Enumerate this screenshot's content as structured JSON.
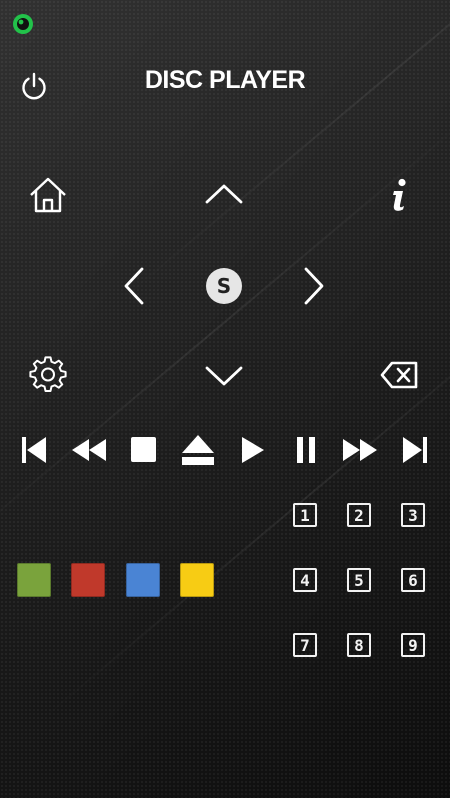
{
  "header": {
    "title": "DISC PLAYER",
    "status_icon": "eye-status-icon",
    "status_color": "#22c24a",
    "power_icon": "power-icon"
  },
  "navigation": {
    "home_icon": "home-icon",
    "info_icon": "info-icon",
    "up_icon": "chevron-up-icon",
    "down_icon": "chevron-down-icon",
    "left_icon": "chevron-left-icon",
    "right_icon": "chevron-right-icon",
    "ok_label": "S",
    "settings_icon": "gear-icon",
    "back_icon": "backspace-icon"
  },
  "transport": [
    "skip-previous-icon",
    "rewind-icon",
    "stop-icon",
    "eject-icon",
    "play-icon",
    "pause-icon",
    "fast-forward-icon",
    "skip-next-icon"
  ],
  "color_keys": [
    {
      "name": "green",
      "color": "#7aa33c"
    },
    {
      "name": "red",
      "color": "#c0392b"
    },
    {
      "name": "blue",
      "color": "#4a84d4"
    },
    {
      "name": "yellow",
      "color": "#f7cc14"
    }
  ],
  "keypad": {
    "keys": [
      "1",
      "2",
      "3",
      "4",
      "5",
      "6",
      "7",
      "8",
      "9"
    ]
  }
}
